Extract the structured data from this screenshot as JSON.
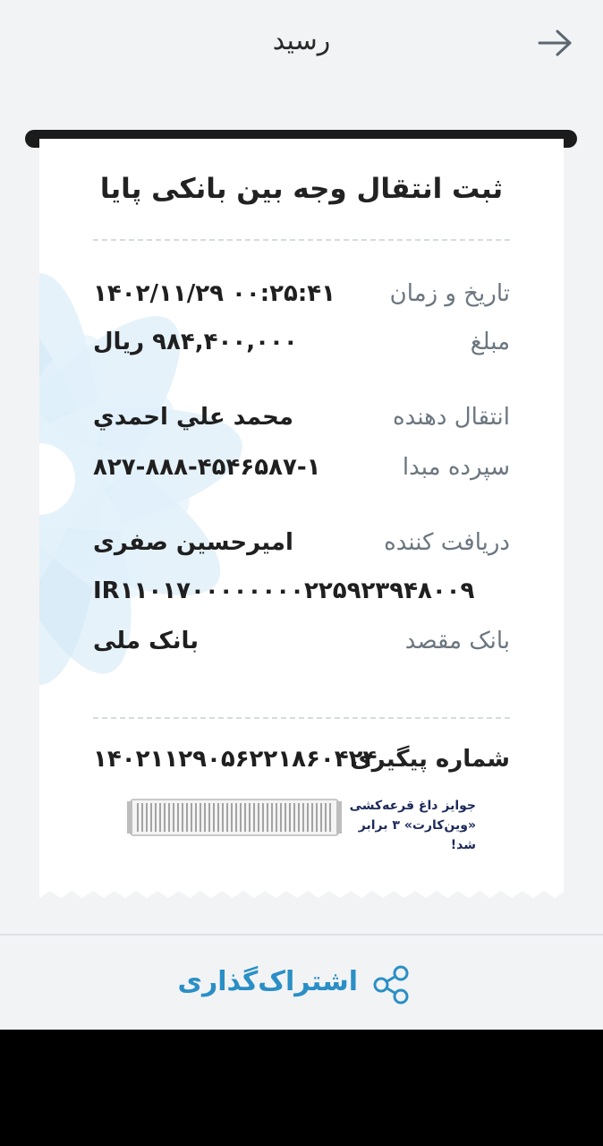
{
  "header": {
    "title": "رسید"
  },
  "receipt": {
    "title": "ثبت انتقال وجه بین بانکی پایا",
    "rows": [
      {
        "label": "تاریخ و زمان",
        "value": "۱۴۰۲/۱۱/۲۹ ۰۰:۲۵:۴۱"
      },
      {
        "label": "مبلغ",
        "value": "۹۸۴,۴۰۰,۰۰۰ ریال"
      },
      {
        "label": "انتقال دهنده",
        "value": "محمد علي احمدي"
      },
      {
        "label": "سپرده مبدا",
        "value": "۸۲۷-۸۸۸-۴۵۴۶۵۸۷-۱"
      },
      {
        "label": "دریافت کننده",
        "value": "امیرحسین صفری"
      },
      {
        "label": "",
        "value": "IR۱۱۰۱۷۰۰۰۰۰۰۰۰۲۲۵۹۲۳۹۴۸۰۰۹"
      },
      {
        "label": "بانک مقصد",
        "value": "بانک ملی"
      }
    ],
    "tracking": {
      "label": "شماره پیگیری",
      "value": "۱۴۰۲۱۱۲۹۰۵۶۲۲۱۸۶۰۴۲۴"
    },
    "ad": {
      "line1": "جوایز داغ قرعه‌کشی",
      "line2": "«وین‌کارت» ۳ برابر شد!"
    }
  },
  "footer": {
    "share_label": "اشتراک‌گذاری"
  },
  "colors": {
    "accent": "#2a8fc6",
    "background": "#f2f3f5",
    "label": "#6b7680"
  },
  "icons": {
    "back": "arrow-right-icon",
    "share": "share-icon"
  }
}
